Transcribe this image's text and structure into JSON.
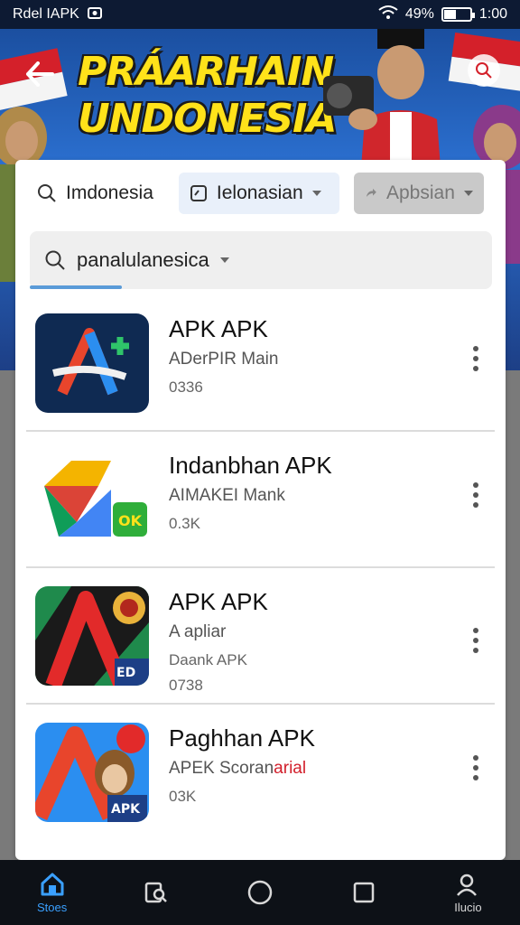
{
  "status_bar": {
    "left_text": "Rdel IAPK",
    "battery": "49%",
    "battery_level": 0.49,
    "time": "1:00"
  },
  "banner": {
    "title_line1": "PRÁARHAIN",
    "title_line2": "UNDONESIA"
  },
  "filters": {
    "search_label": "Imdonesia",
    "language_select": "Ielonasian",
    "disabled_chip": "Apbsian"
  },
  "search": {
    "value": "panalulanesica",
    "progress": 0.2
  },
  "apps": [
    {
      "name": "APK APK",
      "sub1": "ADerPIR Main",
      "sub2": "",
      "sub3": "0336",
      "icon": "apk-a-logo"
    },
    {
      "name": "Indanbhan APK",
      "sub1": "AIMAKEI Mank",
      "sub2": "",
      "sub3": "0.3K",
      "icon": "google-style-logo"
    },
    {
      "name": "APK APK",
      "sub1": "A apliar",
      "sub2": "Daank APK",
      "sub3": "0738",
      "icon": "red-a-logo"
    },
    {
      "name": "Paghhan APK",
      "sub1": "APEK Scoran",
      "sub1_red": "arial",
      "sub2": "",
      "sub3": "03K",
      "icon": "character-logo"
    }
  ],
  "nav": [
    {
      "label": "Stoes",
      "icon": "home-icon",
      "active": true
    },
    {
      "label": "",
      "icon": "search-doc-icon",
      "active": false
    },
    {
      "label": "",
      "icon": "circle-icon",
      "active": false
    },
    {
      "label": "",
      "icon": "square-icon",
      "active": false
    },
    {
      "label": "Ilucio",
      "icon": "profile-icon",
      "active": false
    }
  ],
  "colors": {
    "accent": "#3aa0ff",
    "banner_blue": "#2b6fcf",
    "title_yellow": "#ffe21a",
    "flag_red": "#d4202a"
  }
}
